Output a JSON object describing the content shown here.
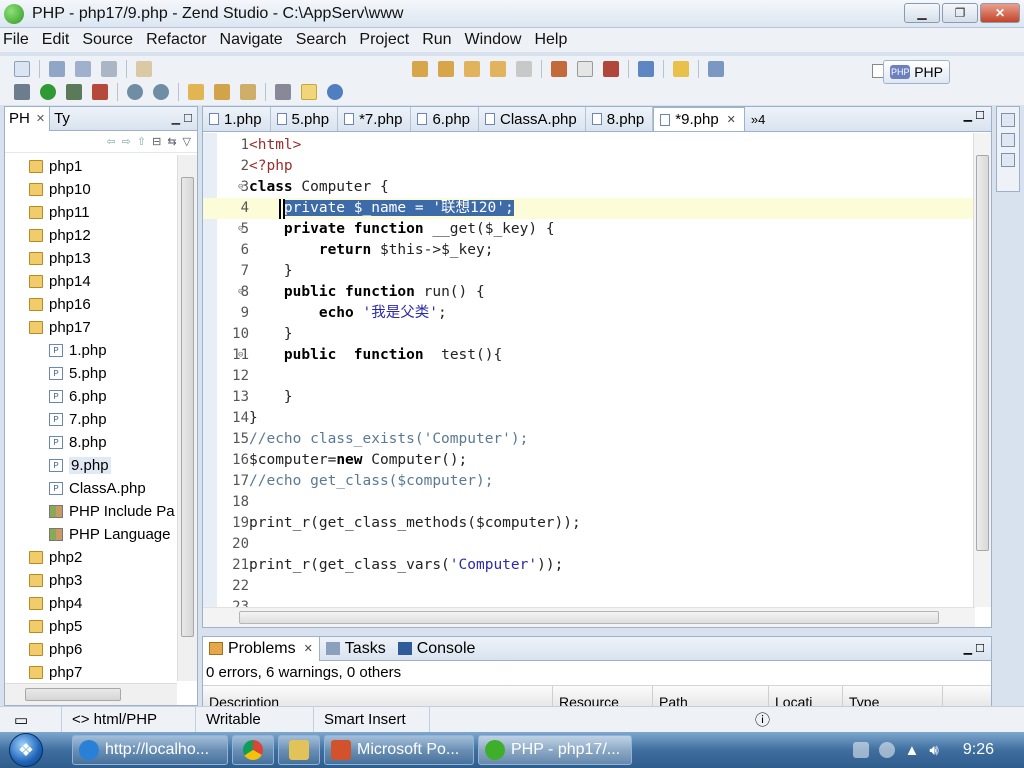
{
  "window": {
    "title": "PHP - php17/9.php - Zend Studio - C:\\AppServ\\www",
    "min": "▁",
    "max": "❐",
    "close": "✕"
  },
  "menu": [
    "File",
    "Edit",
    "Source",
    "Refactor",
    "Navigate",
    "Search",
    "Project",
    "Run",
    "Window",
    "Help"
  ],
  "perspective": {
    "label": "PHP",
    "icon_text": "PHP"
  },
  "explorer": {
    "tabs": [
      {
        "label": "PH",
        "close": "✕"
      },
      {
        "label": "Ty"
      }
    ],
    "tab_controls": "▁ ☐",
    "tree": [
      {
        "label": "php1",
        "type": "folder",
        "indent": 0
      },
      {
        "label": "php10",
        "type": "folder",
        "indent": 0
      },
      {
        "label": "php11",
        "type": "folder",
        "indent": 0
      },
      {
        "label": "php12",
        "type": "folder",
        "indent": 0
      },
      {
        "label": "php13",
        "type": "folder",
        "indent": 0
      },
      {
        "label": "php14",
        "type": "folder",
        "indent": 0
      },
      {
        "label": "php16",
        "type": "folder",
        "indent": 0
      },
      {
        "label": "php17",
        "type": "folder",
        "indent": 0
      },
      {
        "label": "1.php",
        "type": "file",
        "indent": 1
      },
      {
        "label": "5.php",
        "type": "file",
        "indent": 1
      },
      {
        "label": "6.php",
        "type": "file",
        "indent": 1
      },
      {
        "label": "7.php",
        "type": "file",
        "indent": 1
      },
      {
        "label": "8.php",
        "type": "file",
        "indent": 1
      },
      {
        "label": "9.php",
        "type": "file",
        "indent": 1,
        "selected": true
      },
      {
        "label": "ClassA.php",
        "type": "file",
        "indent": 1
      },
      {
        "label": "PHP Include Pa",
        "type": "lib",
        "indent": 1
      },
      {
        "label": "PHP Language",
        "type": "lib",
        "indent": 1
      },
      {
        "label": "php2",
        "type": "folder",
        "indent": 0
      },
      {
        "label": "php3",
        "type": "folder",
        "indent": 0
      },
      {
        "label": "php4",
        "type": "folder",
        "indent": 0
      },
      {
        "label": "php5",
        "type": "folder",
        "indent": 0
      },
      {
        "label": "php6",
        "type": "folder",
        "indent": 0
      },
      {
        "label": "php7",
        "type": "folder",
        "indent": 0
      }
    ]
  },
  "editor": {
    "tabs": [
      {
        "label": "1.php"
      },
      {
        "label": "5.php"
      },
      {
        "label": "*7.php"
      },
      {
        "label": "6.php"
      },
      {
        "label": "ClassA.php"
      },
      {
        "label": "8.php"
      },
      {
        "label": "*9.php",
        "active": true,
        "close": "✕"
      }
    ],
    "more": "»4",
    "controls": "▁ ☐",
    "lines": [
      {
        "n": "1",
        "fold": "",
        "html": "<span class=\"tag\">&lt;html&gt;</span>"
      },
      {
        "n": "2",
        "fold": "",
        "html": "<span class=\"tag\">&lt;?php</span>"
      },
      {
        "n": "3",
        "fold": "⊖",
        "html": "<span class=\"kw\">class</span> Computer {"
      },
      {
        "n": "4",
        "fold": "",
        "cur": true,
        "html": "    <span class=\"selected\">private $_name = '联想120';</span>"
      },
      {
        "n": "5",
        "fold": "⊖",
        "html": "    <span class=\"kw\">private function</span> __get($_key) {"
      },
      {
        "n": "6",
        "fold": "",
        "html": "        <span class=\"kw\">return</span> $this->$_key;"
      },
      {
        "n": "7",
        "fold": "",
        "html": "    }"
      },
      {
        "n": "8",
        "fold": "⊖",
        "html": "    <span class=\"kw\">public function</span> run() {"
      },
      {
        "n": "9",
        "fold": "",
        "html": "        <span class=\"kw\">echo</span> <span class=\"str\">'我是父类'</span>;"
      },
      {
        "n": "10",
        "fold": "",
        "html": "    }"
      },
      {
        "n": "11",
        "fold": "⊖",
        "html": "    <span class=\"kw\">public</span>  <span class=\"kw\">function</span>  test(){"
      },
      {
        "n": "12",
        "fold": "",
        "html": ""
      },
      {
        "n": "13",
        "fold": "",
        "html": "    }"
      },
      {
        "n": "14",
        "fold": "",
        "html": "}"
      },
      {
        "n": "15",
        "fold": "",
        "html": "<span class=\"cm\">//echo class_exists('Computer');</span>"
      },
      {
        "n": "16",
        "fold": "",
        "html": "$computer=<span class=\"kw\">new</span> Computer();"
      },
      {
        "n": "17",
        "fold": "",
        "html": "<span class=\"cm\">//echo get_class($computer);</span>"
      },
      {
        "n": "18",
        "fold": "",
        "html": ""
      },
      {
        "n": "19",
        "fold": "",
        "html": "print_r(get_class_methods($computer));"
      },
      {
        "n": "20",
        "fold": "",
        "html": ""
      },
      {
        "n": "21",
        "fold": "",
        "html": "print_r(get_class_vars(<span class=\"str\">'Computer'</span>));"
      },
      {
        "n": "22",
        "fold": "",
        "html": ""
      },
      {
        "n": "23",
        "fold": "",
        "html": ""
      }
    ]
  },
  "problems": {
    "tabs": [
      {
        "label": "Problems",
        "close": "✕"
      },
      {
        "label": "Tasks"
      },
      {
        "label": "Console"
      }
    ],
    "controls": "▁ ☐",
    "summary": "0 errors, 6 warnings, 0 others",
    "columns": [
      "Description",
      "Resource",
      "Path",
      "Locati",
      "Type"
    ]
  },
  "status": {
    "type": "<> html/PHP",
    "mode": "Writable",
    "insert": "Smart Insert"
  },
  "taskbar": {
    "items": [
      {
        "label": "http://localho...",
        "color": "#2a7fd6"
      },
      {
        "label": "",
        "color": "#e8b33a",
        "pin": true,
        "name": "chrome-icon"
      },
      {
        "label": "",
        "color": "#e2c35a",
        "pin": true,
        "name": "folder-icon"
      },
      {
        "label": "Microsoft Po...",
        "color": "#d2532b"
      },
      {
        "label": "PHP - php17/...",
        "color": "#3fae2a",
        "active": true
      }
    ],
    "clock": "9:26"
  },
  "colors": {
    "selection": "#3d6aa8",
    "current_line": "#fdfcd8",
    "keyword": "#000000",
    "comment": "#5a7a94",
    "string": "#2a2ab0",
    "tag": "#9b2c2c"
  }
}
